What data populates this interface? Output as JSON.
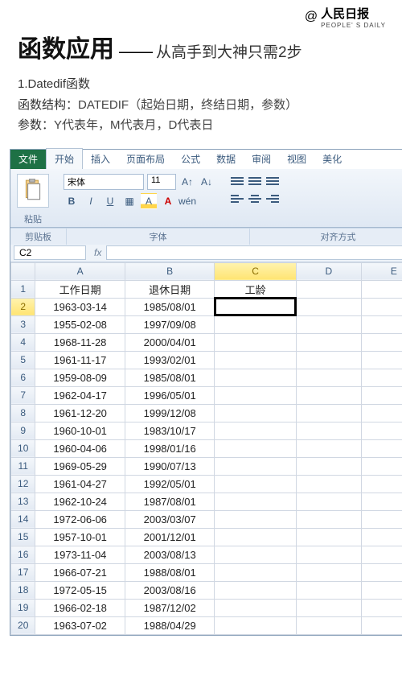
{
  "brand": {
    "at": "@",
    "cn": "人民日报",
    "en": "PEOPLE' S DAILY"
  },
  "title": {
    "main": "函数应用",
    "dash": "——",
    "sub": "从高手到大神只需2步"
  },
  "section": {
    "num": "1.",
    "fn_name": "Datedif函数",
    "struct_label": "函数结构：",
    "struct_val": "DATEDIF（起始日期，终结日期，参数）",
    "param_label": "参数：",
    "param_val": "Y代表年，M代表月，D代表日"
  },
  "ribbon": {
    "tabs": {
      "file": "文件",
      "home": "开始",
      "insert": "插入",
      "layout": "页面布局",
      "formula": "公式",
      "data": "数据",
      "review": "审阅",
      "view": "视图",
      "beautify": "美化"
    },
    "paste": "粘贴",
    "font_name": "宋体",
    "font_size": "11",
    "groups": {
      "clipboard": "剪贴板",
      "font": "字体",
      "align": "对齐方式"
    }
  },
  "grid": {
    "namebox": "C2",
    "fx": "fx",
    "cols": [
      "A",
      "B",
      "C",
      "D",
      "E"
    ],
    "headers": {
      "A": "工作日期",
      "B": "退休日期",
      "C": "工龄"
    },
    "active": {
      "row": 2,
      "col": "C"
    },
    "rows": [
      {
        "n": 1,
        "A": "工作日期",
        "B": "退休日期",
        "C": "工龄"
      },
      {
        "n": 2,
        "A": "1963-03-14",
        "B": "1985/08/01",
        "C": ""
      },
      {
        "n": 3,
        "A": "1955-02-08",
        "B": "1997/09/08",
        "C": ""
      },
      {
        "n": 4,
        "A": "1968-11-28",
        "B": "2000/04/01",
        "C": ""
      },
      {
        "n": 5,
        "A": "1961-11-17",
        "B": "1993/02/01",
        "C": ""
      },
      {
        "n": 6,
        "A": "1959-08-09",
        "B": "1985/08/01",
        "C": ""
      },
      {
        "n": 7,
        "A": "1962-04-17",
        "B": "1996/05/01",
        "C": ""
      },
      {
        "n": 8,
        "A": "1961-12-20",
        "B": "1999/12/08",
        "C": ""
      },
      {
        "n": 9,
        "A": "1960-10-01",
        "B": "1983/10/17",
        "C": ""
      },
      {
        "n": 10,
        "A": "1960-04-06",
        "B": "1998/01/16",
        "C": ""
      },
      {
        "n": 11,
        "A": "1969-05-29",
        "B": "1990/07/13",
        "C": ""
      },
      {
        "n": 12,
        "A": "1961-04-27",
        "B": "1992/05/01",
        "C": ""
      },
      {
        "n": 13,
        "A": "1962-10-24",
        "B": "1987/08/01",
        "C": ""
      },
      {
        "n": 14,
        "A": "1972-06-06",
        "B": "2003/03/07",
        "C": ""
      },
      {
        "n": 15,
        "A": "1957-10-01",
        "B": "2001/12/01",
        "C": ""
      },
      {
        "n": 16,
        "A": "1973-11-04",
        "B": "2003/08/13",
        "C": ""
      },
      {
        "n": 17,
        "A": "1966-07-21",
        "B": "1988/08/01",
        "C": ""
      },
      {
        "n": 18,
        "A": "1972-05-15",
        "B": "2003/08/16",
        "C": ""
      },
      {
        "n": 19,
        "A": "1966-02-18",
        "B": "1987/12/02",
        "C": ""
      },
      {
        "n": 20,
        "A": "1963-07-02",
        "B": "1988/04/29",
        "C": ""
      }
    ]
  }
}
